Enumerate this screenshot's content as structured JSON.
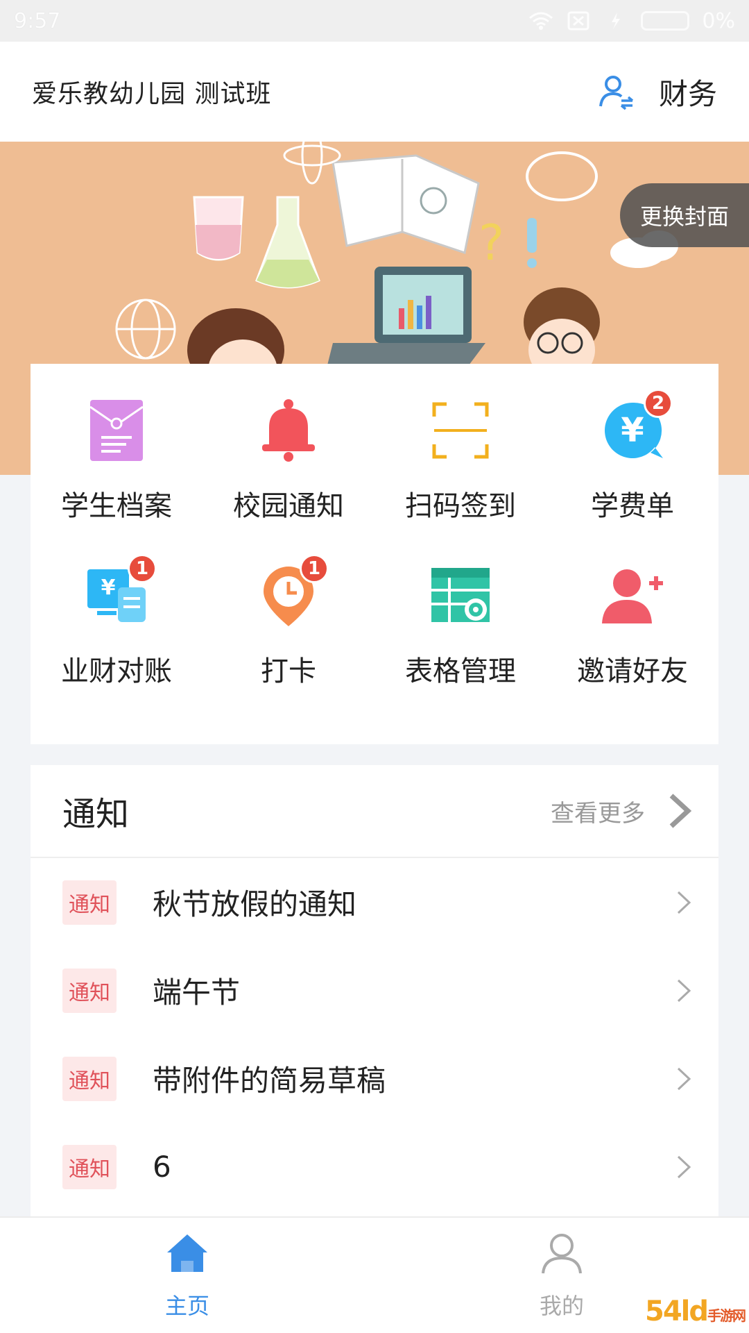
{
  "statusbar": {
    "time": "9:57",
    "battery": "0%"
  },
  "header": {
    "title": "爱乐教幼儿园 测试班",
    "finance_label": "财务"
  },
  "banner": {
    "change_cover": "更换封面"
  },
  "grid": [
    {
      "label": "学生档案",
      "icon": "file-envelope-icon",
      "color": "#d98ee8"
    },
    {
      "label": "校园通知",
      "icon": "bell-icon",
      "color": "#f2545b"
    },
    {
      "label": "扫码签到",
      "icon": "scan-icon",
      "color": "#f2b01e"
    },
    {
      "label": "学费单",
      "icon": "yen-chat-icon",
      "color": "#2db7f5",
      "badge": "2"
    },
    {
      "label": "业财对账",
      "icon": "finance-check-icon",
      "color": "#2db7f5",
      "badge": "1"
    },
    {
      "label": "打卡",
      "icon": "clock-pin-icon",
      "color": "#f68c4d",
      "badge": "1"
    },
    {
      "label": "表格管理",
      "icon": "table-gear-icon",
      "color": "#30c4a6"
    },
    {
      "label": "邀请好友",
      "icon": "add-user-icon",
      "color": "#f05c6a"
    }
  ],
  "notice": {
    "heading": "通知",
    "more_label": "查看更多",
    "items": [
      {
        "tag": "通知",
        "title": "秋节放假的通知"
      },
      {
        "tag": "通知",
        "title": "端午节"
      },
      {
        "tag": "通知",
        "title": "带附件的简易草稿"
      },
      {
        "tag": "通知",
        "title": "6"
      }
    ]
  },
  "bottomnav": {
    "home": "主页",
    "mine": "我的"
  },
  "watermark": {
    "brand": "54ld",
    "sub": "手游网"
  },
  "colors": {
    "accent": "#3a8ee6",
    "tag_bg": "#fde8e8",
    "tag_text": "#e0525a",
    "badge": "#e74c3c"
  }
}
